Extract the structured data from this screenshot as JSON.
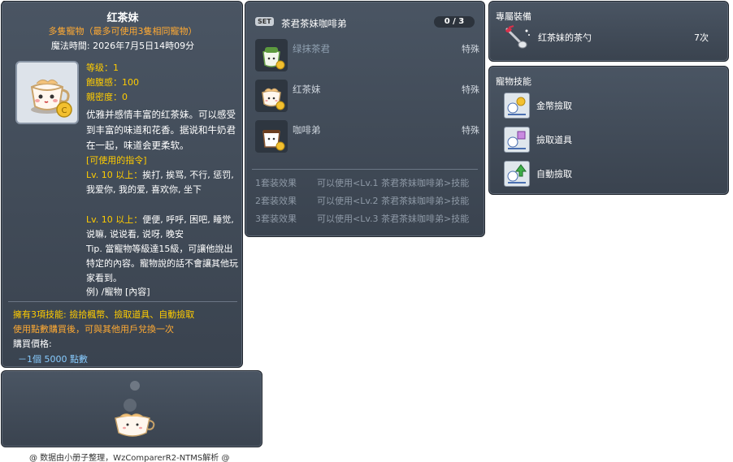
{
  "item_id": "05000426",
  "main": {
    "title": "红茶妹",
    "subtitle": "多隻寵物（最多可使用3隻相同寵物）",
    "magic_time": "魔法時間: 2026年7月5日14時09分",
    "stats": {
      "level": "等级：1",
      "fullness": "飽腹感：100",
      "closeness": "親密度：0"
    },
    "description": "优雅并感情丰富的红茶妹。可以感受到丰富的味道和花香。据说和牛奶君在一起，味道会更柔软。",
    "commands_title": "[可使用的指令]",
    "cmd1_lv": "Lv. 10 以上：",
    "cmd1_text": "挨打, 挨骂, 不行, 惩罚, 我爱你, 我的爱, 喜欢你, 坐下",
    "cmd2_lv": "Lv. 10 以上：",
    "cmd2_text": "便便, 呼呼, 困吧, 睡觉, 说嘛, 说说看, 说呀, 晚安",
    "tip": "Tip. 當寵物等級達15級，可讓他說出特定的內容。寵物說的話不會讓其他玩家看到。",
    "example": "例) /寵物 [內容]",
    "skills_line": "擁有3項技能: 撿拾楓幣、撿取道具、自動撿取",
    "trade_line": "使用點數購買後，可與其他用戶兌換一次",
    "price_label": "購買價格:",
    "price_value": "－1個 5000 點數"
  },
  "footer": "@ 数据由小册子整理，WzComparerR2-NTMS解析 @",
  "set": {
    "badge": "SET",
    "name": "茶君茶妹咖啡弟",
    "count": "0 / 3",
    "items": [
      {
        "name": "绿抹茶君",
        "type": "特殊"
      },
      {
        "name": "红茶妹",
        "type": "特殊"
      },
      {
        "name": "咖啡弟",
        "type": "特殊"
      }
    ],
    "effects": [
      {
        "label": "1套装效果",
        "text": "可以使用<Lv.1 茶君茶妹咖啡弟>技能"
      },
      {
        "label": "2套装效果",
        "text": "可以使用<Lv.2 茶君茶妹咖啡弟>技能"
      },
      {
        "label": "3套装效果",
        "text": "可以使用<Lv.3 茶君茶妹咖啡弟>技能"
      }
    ]
  },
  "equip": {
    "title": "專屬裝備",
    "name": "红茶妹的茶勺",
    "count": "7次"
  },
  "pet_skills": {
    "title": "寵物技能",
    "items": [
      "金幣撿取",
      "撿取道具",
      "自動撿取"
    ]
  }
}
